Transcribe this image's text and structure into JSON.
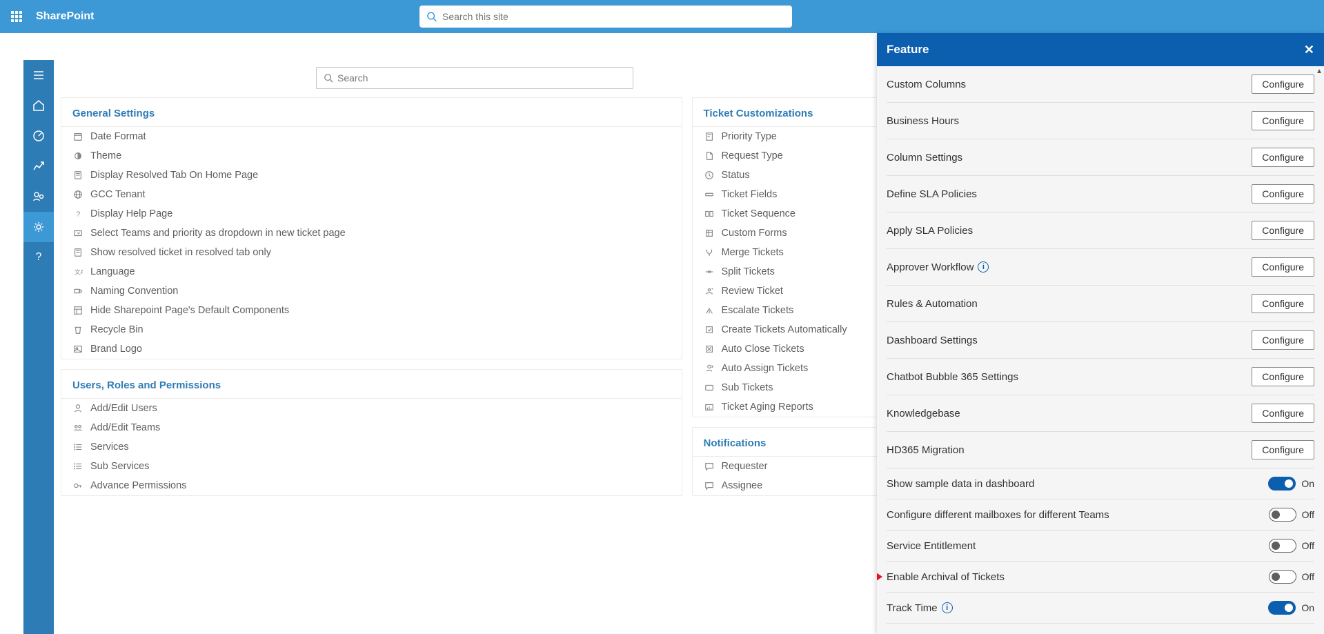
{
  "header": {
    "brand": "SharePoint",
    "search_placeholder": "Search this site"
  },
  "main_search_placeholder": "Search",
  "sections": {
    "general": {
      "title": "General Settings",
      "items": [
        {
          "icon": "calendar",
          "label": "Date Format"
        },
        {
          "icon": "theme",
          "label": "Theme"
        },
        {
          "icon": "doc",
          "label": "Display Resolved Tab On Home Page"
        },
        {
          "icon": "globe",
          "label": "GCC Tenant"
        },
        {
          "icon": "question",
          "label": "Display Help Page"
        },
        {
          "icon": "dropdown",
          "label": "Select Teams and priority as dropdown in new ticket page"
        },
        {
          "icon": "doc",
          "label": "Show resolved ticket in resolved tab only"
        },
        {
          "icon": "lang",
          "label": "Language"
        },
        {
          "icon": "tag",
          "label": "Naming Convention"
        },
        {
          "icon": "layout",
          "label": "Hide Sharepoint Page's Default Components"
        },
        {
          "icon": "trash",
          "label": "Recycle Bin"
        },
        {
          "icon": "image",
          "label": "Brand Logo"
        }
      ]
    },
    "users": {
      "title": "Users, Roles and Permissions",
      "items": [
        {
          "icon": "user",
          "label": "Add/Edit Users"
        },
        {
          "icon": "team",
          "label": "Add/Edit Teams"
        },
        {
          "icon": "list",
          "label": "Services"
        },
        {
          "icon": "list",
          "label": "Sub Services"
        },
        {
          "icon": "key",
          "label": "Advance Permissions"
        }
      ]
    },
    "ticket": {
      "title": "Ticket Customizations",
      "items": [
        {
          "icon": "priority",
          "label": "Priority Type"
        },
        {
          "icon": "file",
          "label": "Request Type"
        },
        {
          "icon": "clock",
          "label": "Status"
        },
        {
          "icon": "fields",
          "label": "Ticket Fields"
        },
        {
          "icon": "seq",
          "label": "Ticket Sequence"
        },
        {
          "icon": "form",
          "label": "Custom Forms"
        },
        {
          "icon": "merge",
          "label": "Merge Tickets"
        },
        {
          "icon": "split",
          "label": "Split Tickets"
        },
        {
          "icon": "review",
          "label": "Review Ticket"
        },
        {
          "icon": "escalate",
          "label": "Escalate Tickets"
        },
        {
          "icon": "auto",
          "label": "Create Tickets Automatically"
        },
        {
          "icon": "close",
          "label": "Auto Close Tickets"
        },
        {
          "icon": "assign",
          "label": "Auto Assign Tickets"
        },
        {
          "icon": "sub",
          "label": "Sub Tickets"
        },
        {
          "icon": "aging",
          "label": "Ticket Aging Reports"
        }
      ]
    },
    "notifications": {
      "title": "Notifications",
      "items": [
        {
          "icon": "chat",
          "label": "Requester"
        },
        {
          "icon": "chat",
          "label": "Assignee"
        }
      ]
    }
  },
  "panel": {
    "title": "Feature",
    "configure_label": "Configure",
    "on_label": "On",
    "off_label": "Off",
    "features": [
      {
        "label": "Custom Columns",
        "type": "configure"
      },
      {
        "label": "Business Hours",
        "type": "configure"
      },
      {
        "label": "Column Settings",
        "type": "configure"
      },
      {
        "label": "Define SLA Policies",
        "type": "configure"
      },
      {
        "label": "Apply SLA Policies",
        "type": "configure"
      },
      {
        "label": "Approver Workflow",
        "type": "configure",
        "info": true
      },
      {
        "label": "Rules & Automation",
        "type": "configure"
      },
      {
        "label": "Dashboard Settings",
        "type": "configure"
      },
      {
        "label": "Chatbot Bubble 365 Settings",
        "type": "configure"
      },
      {
        "label": "Knowledgebase",
        "type": "configure"
      },
      {
        "label": "HD365 Migration",
        "type": "configure"
      },
      {
        "label": "Show sample data in dashboard",
        "type": "toggle",
        "value": true
      },
      {
        "label": "Configure different mailboxes for different Teams",
        "type": "toggle",
        "value": false
      },
      {
        "label": "Service Entitlement",
        "type": "toggle",
        "value": false
      },
      {
        "label": "Enable Archival of Tickets",
        "type": "toggle",
        "value": false,
        "arrow": true
      },
      {
        "label": "Track Time",
        "type": "toggle",
        "value": true,
        "info": true
      }
    ]
  }
}
